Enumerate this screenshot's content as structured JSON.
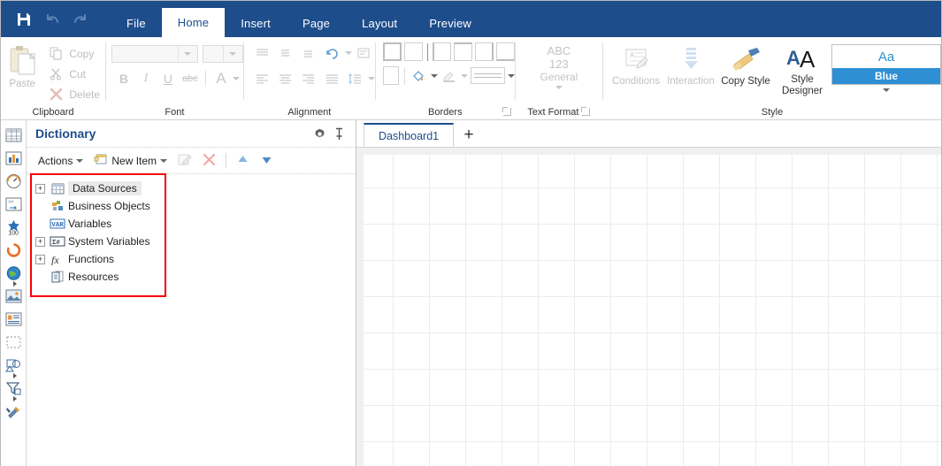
{
  "titlebar": {
    "icons": [
      {
        "name": "save-icon",
        "glyph": "save"
      },
      {
        "name": "undo-icon",
        "glyph": "undo"
      },
      {
        "name": "redo-icon",
        "glyph": "redo"
      }
    ],
    "tabs": [
      {
        "label": "File",
        "active": false
      },
      {
        "label": "Home",
        "active": true
      },
      {
        "label": "Insert",
        "active": false
      },
      {
        "label": "Page",
        "active": false
      },
      {
        "label": "Layout",
        "active": false
      },
      {
        "label": "Preview",
        "active": false
      }
    ]
  },
  "ribbon": {
    "clipboard": {
      "group_label": "Clipboard",
      "paste_label": "Paste",
      "items": [
        {
          "label": "Copy",
          "icon": "copy-icon"
        },
        {
          "label": "Cut",
          "icon": "scissors-icon"
        },
        {
          "label": "Delete",
          "icon": "delete-x-icon"
        }
      ]
    },
    "font": {
      "group_label": "Font",
      "font_name_value": "",
      "font_size_value": "",
      "bold_label": "B",
      "italic_label": "I",
      "underline_label": "U",
      "strike_label": "abc",
      "color_label": "A"
    },
    "alignment": {
      "group_label": "Alignment"
    },
    "borders": {
      "group_label": "Borders"
    },
    "text_format": {
      "group_label": "Text Format",
      "line1": "ABC",
      "line2": "123",
      "line3": "General"
    },
    "conditions": {
      "conditions_label": "Conditions",
      "interaction_label": "Interaction",
      "copy_style_label": "Copy Style"
    },
    "style": {
      "group_label": "Style",
      "style_designer_label_1": "Style",
      "style_designer_label_2": "Designer",
      "gallery_sample": "Aa",
      "gallery_name": "Blue",
      "accent_color": "#2e8fd4"
    }
  },
  "left_strip": [
    {
      "name": "table-icon"
    },
    {
      "name": "bar-chart-icon"
    },
    {
      "name": "gauge-icon"
    },
    {
      "name": "panel-icon"
    },
    {
      "name": "indicator-100-icon",
      "label": "100"
    },
    {
      "name": "progress-donut-icon"
    },
    {
      "name": "globe-map-icon",
      "has_submenu": true
    },
    {
      "name": "image-icon"
    },
    {
      "name": "rich-text-icon"
    },
    {
      "name": "shape-rectangle-icon"
    },
    {
      "name": "shapes-group-icon",
      "has_submenu": true
    },
    {
      "name": "filter-funnel-icon",
      "has_submenu": true
    },
    {
      "name": "tools-icon"
    }
  ],
  "dictionary": {
    "title": "Dictionary",
    "header_icons": [
      {
        "name": "gear-icon"
      },
      {
        "name": "pin-icon"
      }
    ],
    "toolbar": {
      "actions_label": "Actions",
      "new_item_label": "New Item",
      "edit_icon": "edit-icon",
      "delete_icon": "delete-icon",
      "move_up_icon": "move-up-icon",
      "move_down_icon": "move-down-icon"
    },
    "tree": [
      {
        "label": "Data Sources",
        "icon": "data-sources-icon",
        "expandable": true,
        "selected": true
      },
      {
        "label": "Business Objects",
        "icon": "business-objects-icon",
        "expandable": false,
        "selected": false
      },
      {
        "label": "Variables",
        "icon": "variables-icon",
        "expandable": false,
        "selected": false
      },
      {
        "label": "System Variables",
        "icon": "system-variables-icon",
        "expandable": true,
        "selected": false
      },
      {
        "label": "Functions",
        "icon": "functions-icon",
        "expandable": true,
        "selected": false
      },
      {
        "label": "Resources",
        "icon": "resources-icon",
        "expandable": false,
        "selected": false
      }
    ],
    "highlight_color": "#f40000"
  },
  "workspace": {
    "tabs": [
      {
        "label": "Dashboard1",
        "active": true
      }
    ],
    "add_tab_label": "+"
  }
}
